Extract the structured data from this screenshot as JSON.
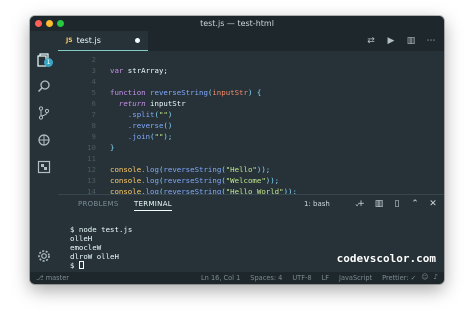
{
  "window": {
    "title": "test.js — test-html"
  },
  "activity_bar": {
    "icons": [
      "files-icon",
      "search-icon",
      "source-control-icon",
      "debug-icon",
      "extensions-icon",
      "settings-icon"
    ],
    "badge": "1"
  },
  "tab": {
    "label": "test.js",
    "icon_text": "JS"
  },
  "editor": {
    "lines": [
      {
        "n": "2"
      },
      {
        "n": "3"
      },
      {
        "n": "4"
      },
      {
        "n": "5"
      },
      {
        "n": "6"
      },
      {
        "n": "7"
      },
      {
        "n": "8"
      },
      {
        "n": "9"
      },
      {
        "n": "10"
      },
      {
        "n": "11"
      },
      {
        "n": "12"
      },
      {
        "n": "13"
      },
      {
        "n": "14"
      },
      {
        "n": "15"
      },
      {
        "n": "16"
      },
      {
        "n": "17"
      }
    ],
    "code": {
      "var_kw": "var",
      "var_name": " strArray;",
      "fn_kw": "function",
      "fn_name": " reverseString",
      "fn_paren_open": "(",
      "fn_param": "inputStr",
      "fn_paren_close": ") {",
      "return_kw": "  return",
      "return_val": " inputStr",
      "split": "    .split",
      "split_arg_open": "(",
      "split_str": "\"\"",
      "split_arg_close": ")",
      "reverse": "    .reverse",
      "reverse_args": "()",
      "join": "    .join",
      "join_arg_open": "(",
      "join_str": "\"\"",
      "join_arg_close": ");",
      "close_brace": "}",
      "log1_obj": "console",
      "log1_fn": ".log",
      "log1_open": "(",
      "log1_call": "reverseString",
      "log1_paren": "(",
      "log1_str": "\"Hello\"",
      "log1_close": "));",
      "log2_obj": "console",
      "log2_fn": ".log",
      "log2_open": "(",
      "log2_call": "reverseString",
      "log2_paren": "(",
      "log2_str": "\"Welcome\"",
      "log2_close": "));",
      "log3_obj": "console",
      "log3_fn": ".log",
      "log3_open": "(",
      "log3_call": "reverseString",
      "log3_paren": "(",
      "log3_str": "\"Hello World\"",
      "log3_close": "));"
    }
  },
  "panel": {
    "tabs": [
      "PROBLEMS",
      "TERMINAL"
    ],
    "active_tab": "TERMINAL",
    "shell": "1: bash",
    "terminal_lines": [
      "$ node test.js",
      "olleH",
      "emocleW",
      "dlroW olleH",
      "$ "
    ]
  },
  "watermark": "codevscolor.com",
  "status_bar": {
    "branch": "master",
    "position": "Ln 16, Col 1",
    "spaces": "Spaces: 4",
    "encoding": "UTF-8",
    "eol": "LF",
    "language": "JavaScript",
    "formatter": "Prettier: ✓"
  },
  "colors": {
    "editor_bg": "#263238",
    "keyword": "#c792ea",
    "function": "#82aaff",
    "param": "#f78c6c",
    "string": "#c3e88d",
    "console": "#ffcb6b"
  }
}
